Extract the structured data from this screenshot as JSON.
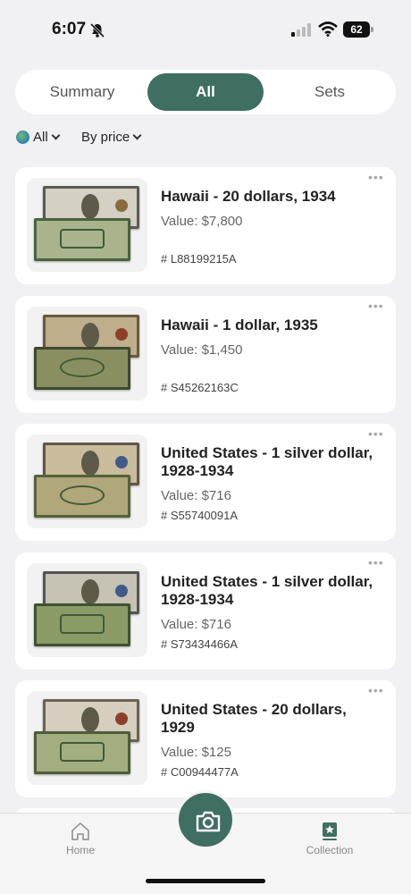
{
  "status": {
    "time": "6:07",
    "battery": "62"
  },
  "tabs": [
    {
      "label": "Summary",
      "active": false
    },
    {
      "label": "All",
      "active": true
    },
    {
      "label": "Sets",
      "active": false
    }
  ],
  "filters": {
    "region": "All",
    "sort": "By price"
  },
  "items": [
    {
      "title": "Hawaii - 20 dollars, 1934",
      "value": "Value: $7,800",
      "serial": "# L88199215A"
    },
    {
      "title": "Hawaii - 1 dollar, 1935",
      "value": "Value: $1,450",
      "serial": "# S45262163C"
    },
    {
      "title": "United States - 1 silver dollar, 1928-1934",
      "value": "Value: $716",
      "serial": "# S55740091A"
    },
    {
      "title": "United States - 1 silver dollar, 1928-1934",
      "value": "Value: $716",
      "serial": "# S73434466A"
    },
    {
      "title": "United States - 20 dollars, 1929",
      "value": "Value: $125",
      "serial": "# C00944477A"
    }
  ],
  "nav": {
    "home": "Home",
    "collection": "Collection"
  },
  "colors": {
    "accent": "#3f6e62",
    "background": "#f1f1f3"
  },
  "icons": [
    "bell-off-icon",
    "signal-icon",
    "wifi-icon",
    "battery-icon",
    "globe-icon",
    "chevron-down-icon",
    "more-icon",
    "home-icon",
    "camera-icon",
    "collection-icon"
  ]
}
